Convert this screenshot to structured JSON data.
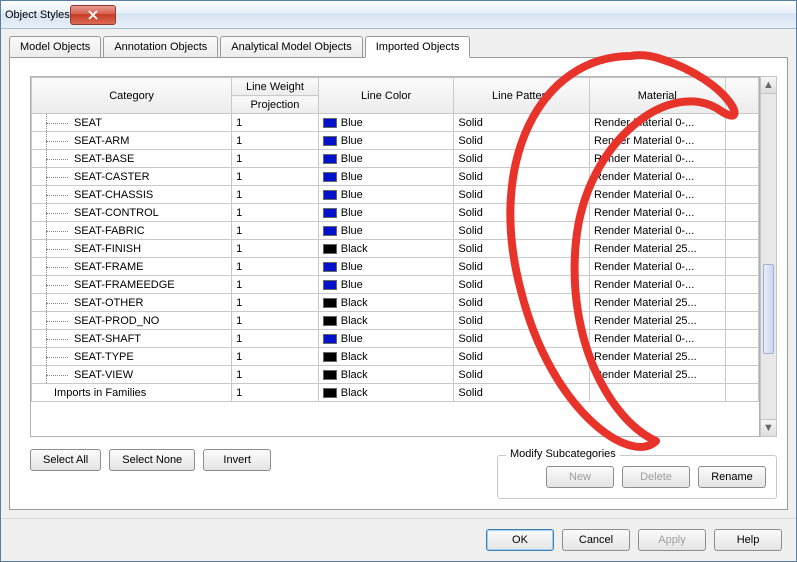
{
  "window": {
    "title": "Object Styles"
  },
  "tabs": [
    {
      "label": "Model Objects"
    },
    {
      "label": "Annotation Objects"
    },
    {
      "label": "Analytical Model Objects"
    },
    {
      "label": "Imported Objects"
    }
  ],
  "active_tab": 3,
  "headers": {
    "category": "Category",
    "line_weight": "Line Weight",
    "projection": "Projection",
    "line_color": "Line Color",
    "line_pattern": "Line Pattern",
    "material": "Material"
  },
  "rows": [
    {
      "name": "SEAT",
      "indent": true,
      "lw": "1",
      "color": "Blue",
      "swatch": "blue",
      "pattern": "Solid",
      "material": "Render Material 0-..."
    },
    {
      "name": "SEAT-ARM",
      "indent": true,
      "lw": "1",
      "color": "Blue",
      "swatch": "blue",
      "pattern": "Solid",
      "material": "Render Material 0-..."
    },
    {
      "name": "SEAT-BASE",
      "indent": true,
      "lw": "1",
      "color": "Blue",
      "swatch": "blue",
      "pattern": "Solid",
      "material": "Render Material 0-..."
    },
    {
      "name": "SEAT-CASTER",
      "indent": true,
      "lw": "1",
      "color": "Blue",
      "swatch": "blue",
      "pattern": "Solid",
      "material": "Render Material 0-..."
    },
    {
      "name": "SEAT-CHASSIS",
      "indent": true,
      "lw": "1",
      "color": "Blue",
      "swatch": "blue",
      "pattern": "Solid",
      "material": "Render Material 0-..."
    },
    {
      "name": "SEAT-CONTROL",
      "indent": true,
      "lw": "1",
      "color": "Blue",
      "swatch": "blue",
      "pattern": "Solid",
      "material": "Render Material 0-..."
    },
    {
      "name": "SEAT-FABRIC",
      "indent": true,
      "lw": "1",
      "color": "Blue",
      "swatch": "blue",
      "pattern": "Solid",
      "material": "Render Material 0-..."
    },
    {
      "name": "SEAT-FINISH",
      "indent": true,
      "lw": "1",
      "color": "Black",
      "swatch": "black",
      "pattern": "Solid",
      "material": "Render Material 25..."
    },
    {
      "name": "SEAT-FRAME",
      "indent": true,
      "lw": "1",
      "color": "Blue",
      "swatch": "blue",
      "pattern": "Solid",
      "material": "Render Material 0-..."
    },
    {
      "name": "SEAT-FRAMEEDGE",
      "indent": true,
      "lw": "1",
      "color": "Blue",
      "swatch": "blue",
      "pattern": "Solid",
      "material": "Render Material 0-..."
    },
    {
      "name": "SEAT-OTHER",
      "indent": true,
      "lw": "1",
      "color": "Black",
      "swatch": "black",
      "pattern": "Solid",
      "material": "Render Material 25..."
    },
    {
      "name": "SEAT-PROD_NO",
      "indent": true,
      "lw": "1",
      "color": "Black",
      "swatch": "black",
      "pattern": "Solid",
      "material": "Render Material 25..."
    },
    {
      "name": "SEAT-SHAFT",
      "indent": true,
      "lw": "1",
      "color": "Blue",
      "swatch": "blue",
      "pattern": "Solid",
      "material": "Render Material 0-..."
    },
    {
      "name": "SEAT-TYPE",
      "indent": true,
      "lw": "1",
      "color": "Black",
      "swatch": "black",
      "pattern": "Solid",
      "material": "Render Material 25..."
    },
    {
      "name": "SEAT-VIEW",
      "indent": true,
      "lw": "1",
      "color": "Black",
      "swatch": "black",
      "pattern": "Solid",
      "material": "Render Material 25..."
    },
    {
      "name": "Imports in Families",
      "indent": false,
      "lw": "1",
      "color": "Black",
      "swatch": "black",
      "pattern": "Solid",
      "material": ""
    }
  ],
  "buttons": {
    "select_all": "Select All",
    "select_none": "Select None",
    "invert": "Invert"
  },
  "group": {
    "title": "Modify Subcategories",
    "new": "New",
    "delete": "Delete",
    "rename": "Rename"
  },
  "footer": {
    "ok": "OK",
    "cancel": "Cancel",
    "apply": "Apply",
    "help": "Help"
  },
  "annotation": {
    "stroke": "#e8332b"
  }
}
